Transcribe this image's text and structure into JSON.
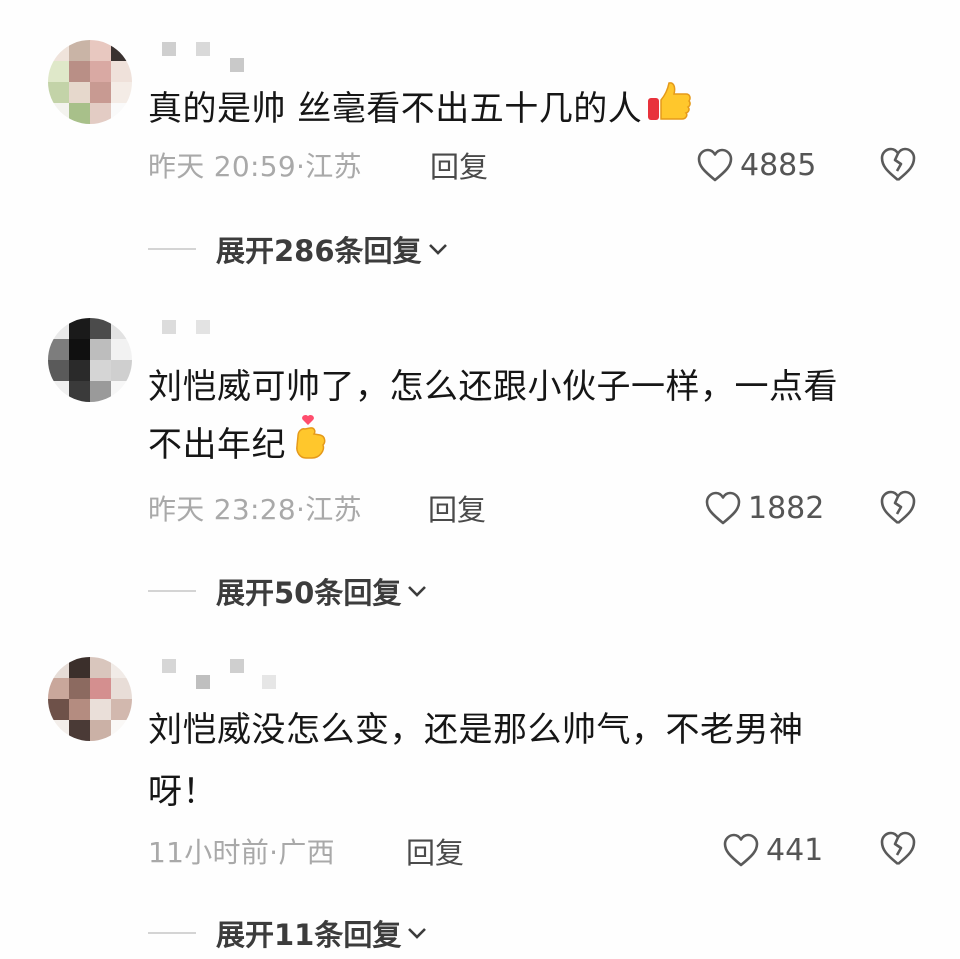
{
  "comments": [
    {
      "text": "真的是帅 丝毫看不出五十几的人",
      "emoji_icon": "thumbs-up-icon",
      "time": "昨天 20:59",
      "location": "江苏",
      "reply_label": "回复",
      "likes": "4885",
      "expand_label": "展开286条回复"
    },
    {
      "text_line1": "刘恺威可帅了，怎么还跟小伙子一样，一点看",
      "text_line2": "不出年纪",
      "emoji_icon": "finger-heart-icon",
      "time": "昨天 23:28",
      "location": "江苏",
      "reply_label": "回复",
      "likes": "1882",
      "expand_label": "展开50条回复"
    },
    {
      "text_line1": "刘恺威没怎么变，还是那么帅气，不老男神",
      "text_line2": "呀！",
      "time": "11小时前",
      "location": "广西",
      "reply_label": "回复",
      "likes": "441",
      "expand_label": "展开11条回复"
    }
  ],
  "separator": "·",
  "colors": {
    "meta": "#a9a9a9",
    "text": "#161616",
    "expand": "#3c3c3c",
    "icon": "#5a5a5a"
  }
}
